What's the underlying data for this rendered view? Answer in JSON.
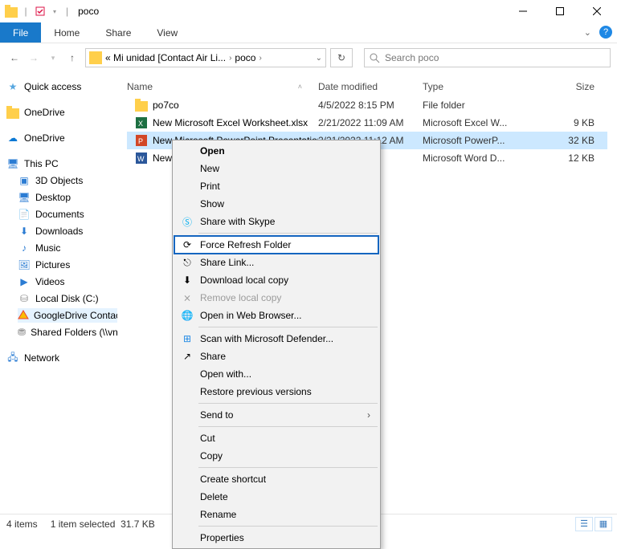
{
  "window": {
    "title": "poco"
  },
  "tabs": {
    "file": "File",
    "home": "Home",
    "share": "Share",
    "view": "View"
  },
  "address": {
    "crumb1": "« Mi unidad [Contact Air Li...",
    "crumb2": "poco"
  },
  "search": {
    "placeholder": "Search poco"
  },
  "tree": {
    "quickaccess": "Quick access",
    "onedrive1": "OneDrive",
    "onedrive2": "OneDrive",
    "thispc": "This PC",
    "objects3d": "3D Objects",
    "desktop": "Desktop",
    "documents": "Documents",
    "downloads": "Downloads",
    "music": "Music",
    "pictures": "Pictures",
    "videos": "Videos",
    "localdisk": "Local Disk (C:)",
    "googledrive": "GoogleDrive Contac",
    "sharedfolders": "Shared Folders (\\\\vn",
    "network": "Network"
  },
  "columns": {
    "name": "Name",
    "date": "Date modified",
    "type": "Type",
    "size": "Size"
  },
  "rows": [
    {
      "name": "po7co",
      "date": "4/5/2022 8:15 PM",
      "type": "File folder",
      "size": ""
    },
    {
      "name": "New Microsoft Excel Worksheet.xlsx",
      "date": "2/21/2022 11:09 AM",
      "type": "Microsoft Excel W...",
      "size": "9 KB"
    },
    {
      "name": "New Microsoft PowerPoint Presentation",
      "date": "2/21/2022 11:12 AM",
      "type": "Microsoft PowerP...",
      "size": "32 KB"
    },
    {
      "name": "New M",
      "date": "0 AM",
      "type": "Microsoft Word D...",
      "size": "12 KB"
    }
  ],
  "menu": {
    "open": "Open",
    "new": "New",
    "print": "Print",
    "show": "Show",
    "skype": "Share with Skype",
    "forcerefresh": "Force Refresh Folder",
    "sharelink": "Share Link...",
    "download": "Download local copy",
    "remove": "Remove local copy",
    "openweb": "Open in Web Browser...",
    "defender": "Scan with Microsoft Defender...",
    "share": "Share",
    "openwith": "Open with...",
    "restore": "Restore previous versions",
    "sendto": "Send to",
    "cut": "Cut",
    "copy": "Copy",
    "shortcut": "Create shortcut",
    "delete": "Delete",
    "rename": "Rename",
    "properties": "Properties"
  },
  "status": {
    "items": "4 items",
    "selected": "1 item selected",
    "size": "31.7 KB"
  }
}
